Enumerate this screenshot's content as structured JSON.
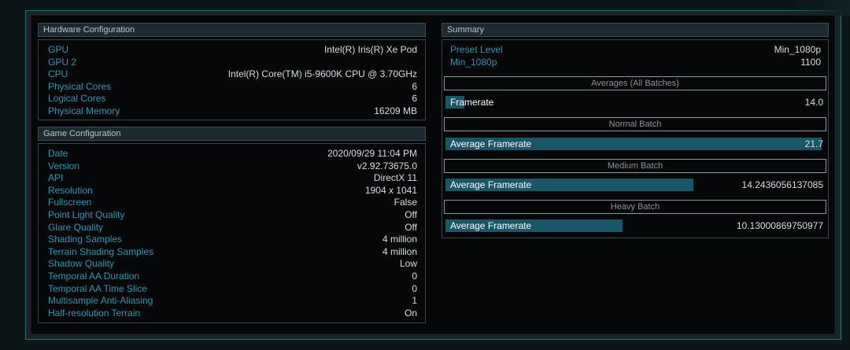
{
  "hardware": {
    "title": "Hardware Configuration",
    "rows": [
      {
        "label": "GPU",
        "value": "Intel(R) Iris(R) Xe Pod"
      },
      {
        "label": "GPU 2",
        "value": ""
      },
      {
        "label": "CPU",
        "value": "Intel(R) Core(TM) i5-9600K CPU @ 3.70GHz"
      },
      {
        "label": "Physical Cores",
        "value": "6"
      },
      {
        "label": "Logical Cores",
        "value": "6"
      },
      {
        "label": "Physical Memory",
        "value": "16209 MB"
      }
    ]
  },
  "game": {
    "title": "Game Configuration",
    "rows": [
      {
        "label": "Date",
        "value": "2020/09/29 11:04 PM"
      },
      {
        "label": "Version",
        "value": "v2.92.73675.0"
      },
      {
        "label": "API",
        "value": "DirectX 11"
      },
      {
        "label": "Resolution",
        "value": "1904 x 1041"
      },
      {
        "label": "Fullscreen",
        "value": "False"
      },
      {
        "label": "Point Light Quality",
        "value": "Off"
      },
      {
        "label": "Glare Quality",
        "value": "Off"
      },
      {
        "label": "Shading Samples",
        "value": "4 million"
      },
      {
        "label": "Terrain Shading Samples",
        "value": "4 million"
      },
      {
        "label": "Shadow Quality",
        "value": "Low"
      },
      {
        "label": "Temporal AA Duration",
        "value": "0"
      },
      {
        "label": "Temporal AA Time Slice",
        "value": "0"
      },
      {
        "label": "Multisample Anti-Aliasing",
        "value": "1"
      },
      {
        "label": "Half-resolution Terrain",
        "value": "On"
      }
    ]
  },
  "summary": {
    "title": "Summary",
    "preset_label": "Preset Level",
    "preset_value": "Min_1080p",
    "score_label": "Min_1080p",
    "score_value": "1100",
    "averages_title": "Averages (All Batches)",
    "averages_label": "Framerate",
    "averages_value": "14.0",
    "averages_fill": 0.05,
    "normal_title": "Normal Batch",
    "normal_label": "Average Framerate",
    "normal_value": "21.7",
    "normal_fill": 1.0,
    "medium_title": "Medium Batch",
    "medium_label": "Average Framerate",
    "medium_value": "14.2436056137085",
    "medium_fill": 0.66,
    "heavy_title": "Heavy Batch",
    "heavy_label": "Average Framerate",
    "heavy_value": "10.13000869750977",
    "heavy_fill": 0.47
  },
  "colors": {
    "label": "#2f98b4",
    "value": "#d8dfe2",
    "bar": "#18566a",
    "frame": "#2c6f74"
  }
}
